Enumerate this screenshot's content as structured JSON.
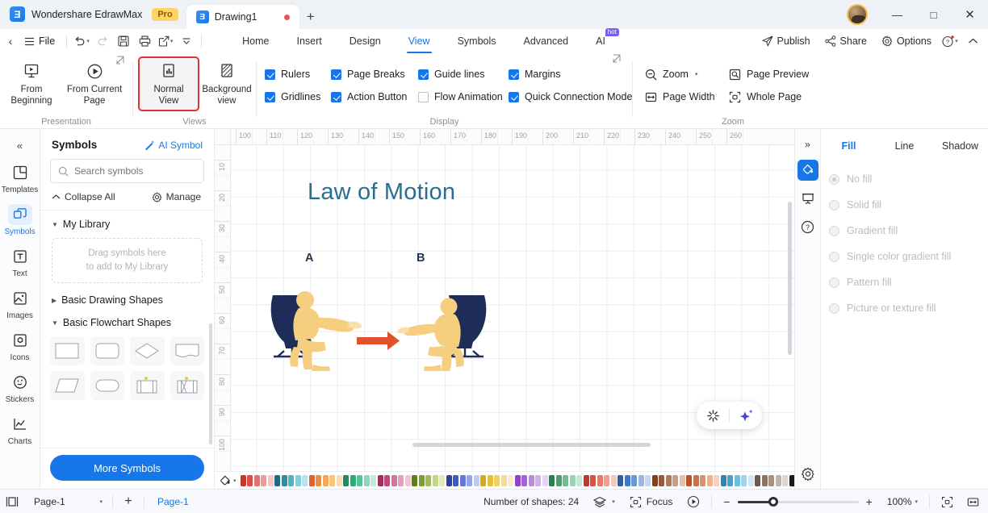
{
  "titlebar": {
    "brand_name": "Wondershare EdrawMax",
    "pro_badge": "Pro",
    "document_tab": "Drawing1",
    "new_tab_label": "+",
    "minimize_label": "—",
    "maximize_label": "□",
    "close_label": "✕"
  },
  "menubar": {
    "back_label": "‹",
    "file_label": "File",
    "undo_label": "↶",
    "redo_label": "↷",
    "save_label": "💾",
    "print_label": "🖨",
    "export_label": "↗",
    "more_label": "⌄",
    "tabs": [
      {
        "label": "Home",
        "active": false
      },
      {
        "label": "Insert",
        "active": false
      },
      {
        "label": "Design",
        "active": false
      },
      {
        "label": "View",
        "active": true
      },
      {
        "label": "Symbols",
        "active": false
      },
      {
        "label": "Advanced",
        "active": false
      },
      {
        "label": "AI",
        "active": false,
        "badge": "hot"
      }
    ],
    "right_items": [
      {
        "label": "Publish",
        "icon": "publish-icon"
      },
      {
        "label": "Share",
        "icon": "share-icon"
      },
      {
        "label": "Options",
        "icon": "gear-icon"
      }
    ],
    "help_label": "?",
    "collapse_label": "⌃"
  },
  "ribbon": {
    "presentation": {
      "group_label": "Presentation",
      "buttons": [
        {
          "label": "From\nBeginning",
          "line1": "From",
          "line2": "Beginning",
          "icon": "present-screen-icon"
        },
        {
          "label": "From Current Page",
          "line1": "From Current",
          "line2": "Page",
          "icon": "play-circle-icon"
        }
      ]
    },
    "views": {
      "group_label": "Views",
      "buttons": [
        {
          "line1": "Normal",
          "line2": "View",
          "icon": "normal-view-icon",
          "selected": true
        },
        {
          "line1": "Background",
          "line2": "view",
          "icon": "background-view-icon",
          "selected": false
        }
      ]
    },
    "display": {
      "group_label": "Display",
      "checkboxes": [
        {
          "label": "Rulers",
          "checked": true
        },
        {
          "label": "Page Breaks",
          "checked": true
        },
        {
          "label": "Guide lines",
          "checked": true
        },
        {
          "label": "Margins",
          "checked": true
        },
        {
          "label": "Gridlines",
          "checked": true
        },
        {
          "label": "Action Button",
          "checked": true
        },
        {
          "label": "Flow Animation",
          "checked": false
        },
        {
          "label": "Quick Connection Mode",
          "checked": true
        }
      ]
    },
    "zoom": {
      "group_label": "Zoom",
      "buttons": [
        {
          "label": "Zoom",
          "icon": "zoom-out-icon",
          "has_caret": true
        },
        {
          "label": "Page Preview",
          "icon": "page-preview-icon",
          "has_caret": false
        },
        {
          "label": "Page Width",
          "icon": "page-width-icon",
          "has_caret": false
        },
        {
          "label": "Whole Page",
          "icon": "whole-page-icon",
          "has_caret": false
        }
      ]
    }
  },
  "rail": {
    "collapse_label": "«",
    "items": [
      {
        "label": "Templates",
        "icon": "templates-icon",
        "active": false
      },
      {
        "label": "Symbols",
        "icon": "symbols-icon",
        "active": true
      },
      {
        "label": "Text",
        "icon": "text-icon",
        "active": false
      },
      {
        "label": "Images",
        "icon": "images-icon",
        "active": false
      },
      {
        "label": "Icons",
        "icon": "icons-icon",
        "active": false
      },
      {
        "label": "Stickers",
        "icon": "stickers-icon",
        "active": false
      },
      {
        "label": "Charts",
        "icon": "charts-icon",
        "active": false
      }
    ]
  },
  "symbols_panel": {
    "title": "Symbols",
    "ai_symbol_label": "AI Symbol",
    "search_placeholder": "Search symbols",
    "search_value": "",
    "collapse_all_label": "Collapse All",
    "manage_label": "Manage",
    "sections": [
      {
        "label": "My Library",
        "expanded": true
      },
      {
        "label": "Basic Drawing Shapes",
        "expanded": false
      },
      {
        "label": "Basic Flowchart Shapes",
        "expanded": true
      }
    ],
    "drop_area_line1": "Drag symbols here",
    "drop_area_line2": "to add to My Library",
    "shape_names": [
      "rectangle",
      "rounded-rectangle",
      "diamond",
      "document",
      "parallelogram",
      "stadium",
      "predefined-process",
      "internal-storage"
    ],
    "more_symbols_label": "More Symbols"
  },
  "canvas": {
    "ruler_h_ticks": [
      "100",
      "110",
      "120",
      "130",
      "140",
      "150",
      "160",
      "170",
      "180",
      "190",
      "200",
      "210",
      "220",
      "230",
      "240",
      "250",
      "260"
    ],
    "ruler_v_ticks": [
      "10",
      "20",
      "30",
      "40",
      "50",
      "60",
      "70",
      "80",
      "90",
      "100"
    ],
    "document_title": "Law of Motion",
    "label_a": "A",
    "label_b": "B",
    "colors": {
      "title_color": "#2a6d8f",
      "chair_color": "#1d2d57",
      "person_color": "#f5ce7f",
      "arrow_color": "#e0532a",
      "grid_color": "#e9ecf1"
    },
    "ai_buttons": [
      {
        "name": "ai-assist-icon",
        "label": "✳"
      },
      {
        "name": "ai-sparkle-icon",
        "label": "✦"
      }
    ]
  },
  "dock": {
    "collapse_label": "»",
    "buttons": [
      {
        "icon": "fill-bucket-icon",
        "active": true
      },
      {
        "icon": "presentation-icon",
        "active": false
      },
      {
        "icon": "help-circle-icon",
        "active": false
      }
    ],
    "gear_icon": "settings-gear-icon"
  },
  "properties": {
    "tabs": [
      {
        "label": "Fill",
        "active": true
      },
      {
        "label": "Line",
        "active": false
      },
      {
        "label": "Shadow",
        "active": false
      }
    ],
    "fill_options": [
      {
        "label": "No fill",
        "selected": true
      },
      {
        "label": "Solid fill",
        "selected": false
      },
      {
        "label": "Gradient fill",
        "selected": false
      },
      {
        "label": "Single color gradient fill",
        "selected": false
      },
      {
        "label": "Pattern fill",
        "selected": false
      },
      {
        "label": "Picture or texture fill",
        "selected": false
      }
    ]
  },
  "status": {
    "view_icon": "page-layout-icon",
    "page_select_value": "Page-1",
    "page_select_caret": "▾",
    "add_page_label": "+",
    "page_chip": "Page-1",
    "shape_count": "Number of shapes: 24",
    "layers_icon": "layers-icon",
    "focus_label": "Focus",
    "play_icon": "play-circle-icon",
    "zoom_out_label": "−",
    "zoom_in_label": "+",
    "zoom_value": "100%",
    "zoom_caret": "▾",
    "fit_page_icon": "fit-page-icon",
    "fit_width_icon": "fit-width-icon"
  },
  "palette": {
    "tool_icon": "fill-color-icon",
    "swatches": [
      "#c0392b",
      "#e04b4b",
      "#e86f6f",
      "#ef9a9a",
      "#f6c6c6",
      "#1a6e7e",
      "#2b8fa3",
      "#4fb3c4",
      "#84cedb",
      "#b8e4ec",
      "#e2622a",
      "#ef8b3c",
      "#f5a85a",
      "#f8c47e",
      "#fbdca8",
      "#1f8a5f",
      "#2eab78",
      "#55c49a",
      "#8ad9bd",
      "#bfeadc",
      "#9b2f5f",
      "#bd4a7e",
      "#d4749c",
      "#e49fbc",
      "#f0c5d6",
      "#5f7d1f",
      "#7e9f2e",
      "#a0bd55",
      "#c2d68a",
      "#dfe9bf",
      "#2a3fa0",
      "#3f5ac4",
      "#6479d6",
      "#92a4e4",
      "#c0cbf0",
      "#d6a81f",
      "#e6bd3c",
      "#eecf6a",
      "#f4de99",
      "#f9ecc6",
      "#8e44c4",
      "#a463d6",
      "#bb8ae0",
      "#d1b0ea",
      "#e6d5f4",
      "#2e7d4f",
      "#49a06d",
      "#71bb8f",
      "#9ed2b4",
      "#cbe6d6",
      "#c0382a",
      "#d9533f",
      "#e5796a",
      "#eda096",
      "#f4c7c1",
      "#2b5fa8",
      "#3f79c6",
      "#6b97d6",
      "#9ab6e4",
      "#c7d5f0",
      "#7a4424",
      "#96593a",
      "#b07a5c",
      "#c89e87",
      "#ddc2b3",
      "#b9542a",
      "#ce6f45",
      "#dd9168",
      "#e9b392",
      "#f2d3bf",
      "#2f86b5",
      "#4ba0cd",
      "#74badc",
      "#a1d2e8",
      "#cde7f3",
      "#6f5a4a",
      "#8c7463",
      "#a89183",
      "#c4b3a8",
      "#ded5cd",
      "#1b1b1b",
      "#2f2f2f",
      "#474747",
      "#5f5f5f",
      "#787878",
      "#919191",
      "#aaaaaa",
      "#c3c3c3",
      "#dcdcdc",
      "#f0f0f0"
    ]
  }
}
